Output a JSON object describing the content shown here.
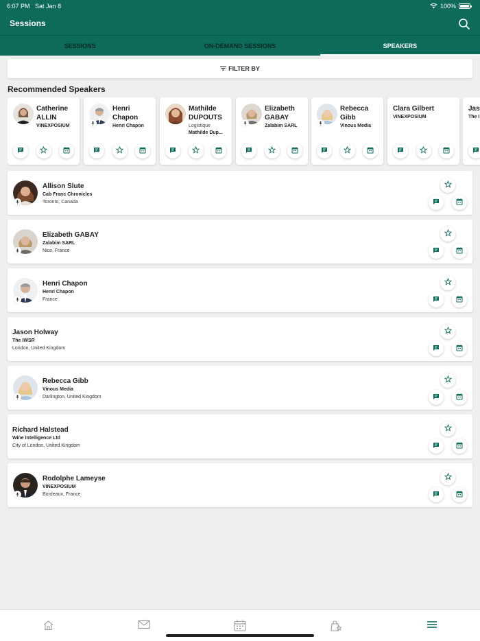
{
  "status": {
    "time": "6:07 PM",
    "date": "Sat Jan 8",
    "battery": "100%"
  },
  "header": {
    "title": "Sessions"
  },
  "tabs": [
    {
      "label": "SESSIONS",
      "active": false
    },
    {
      "label": "ON-DEMAND SESSIONS",
      "active": false
    },
    {
      "label": "SPEAKERS",
      "active": true
    }
  ],
  "filter": {
    "label": "FILTER BY"
  },
  "recommended": {
    "title": "Recommended Speakers",
    "cards": [
      {
        "name": "Catherine ALLIN",
        "org": "VINEXPOSIUM",
        "sub": "",
        "sub2": "",
        "has_photo": true
      },
      {
        "name": "Henri Chapon",
        "org": "Henri Chapon",
        "sub": "",
        "sub2": "",
        "has_photo": true
      },
      {
        "name": "Mathilde DUPOUTS",
        "org": "",
        "sub": "Logistique",
        "sub2": "Mathilde Dup...",
        "has_photo": true
      },
      {
        "name": "Elizabeth GABAY",
        "org": "Zalabim SARL",
        "sub": "",
        "sub2": "",
        "has_photo": true
      },
      {
        "name": "Rebecca Gibb",
        "org": "Vinous Media",
        "sub": "",
        "sub2": "",
        "has_photo": true
      },
      {
        "name": "Clara Gilbert",
        "org": "VINEXPOSIUM",
        "sub": "",
        "sub2": "",
        "has_photo": false
      },
      {
        "name": "Jaso",
        "org": "The I",
        "sub": "",
        "sub2": "",
        "has_photo": false
      }
    ]
  },
  "speakers": [
    {
      "name": "Allison Slute",
      "org": "Cab Franc Chronicles",
      "location": "Toronto, Canada",
      "has_photo": true
    },
    {
      "name": "Elizabeth GABAY",
      "org": "Zalabim SARL",
      "location": "Nice, France",
      "has_photo": true
    },
    {
      "name": "Henri Chapon",
      "org": "Henri Chapon",
      "location": "France",
      "has_photo": true
    },
    {
      "name": "Jason Holway",
      "org": "The IWSR",
      "location": "London, United Kingdom",
      "has_photo": false
    },
    {
      "name": "Rebecca Gibb",
      "org": "Vinous Media",
      "location": "Darlington, United Kingdom",
      "has_photo": true
    },
    {
      "name": "Richard Halstead",
      "org": "Wine Intelligence Ltd",
      "location": "City of London, United Kingdom",
      "has_photo": false
    },
    {
      "name": "Rodolphe Lameyse",
      "org": "VINEXPOSIUM",
      "location": "Bordeaux, France",
      "has_photo": true
    }
  ],
  "bottom_nav": [
    {
      "icon": "home-icon",
      "active": false
    },
    {
      "icon": "mail-icon",
      "active": false
    },
    {
      "icon": "calendar-icon",
      "active": false
    },
    {
      "icon": "bag-star-icon",
      "active": false
    },
    {
      "icon": "menu-icon",
      "active": true
    }
  ],
  "colors": {
    "brand": "#0e6b5a",
    "background": "#efefef"
  }
}
